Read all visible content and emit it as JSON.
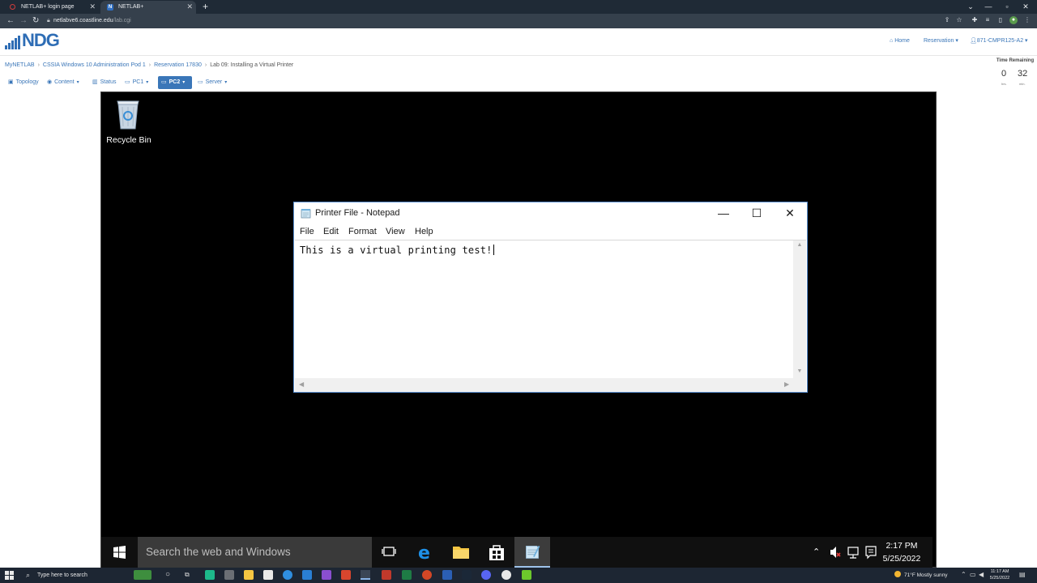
{
  "browser": {
    "tabs": [
      {
        "title": "NETLAB+ login page"
      },
      {
        "title": "NETLAB+"
      }
    ],
    "new_tab": "+",
    "url_host": "netlabve6.coastline.edu",
    "url_path": "/lab.cgi"
  },
  "netlab": {
    "logo_text": "NDG",
    "header": {
      "home": "Home",
      "reservation": "Reservation",
      "user": "871-CMPR125-A2"
    },
    "breadcrumb": [
      "MyNETLAB",
      "CSSIA Windows 10 Administration Pod 1",
      "Reservation 17830",
      "Lab 09: Installing a Virtual Printer"
    ],
    "timer": {
      "label": "Time Remaining",
      "hours": "0",
      "minutes": "32",
      "hours_unit": "hrs.",
      "minutes_unit": "min."
    },
    "tabs": [
      {
        "label": "Topology",
        "icon": "topology-icon"
      },
      {
        "label": "Content",
        "icon": "content-icon"
      },
      {
        "label": "Status",
        "icon": "status-icon"
      },
      {
        "label": "PC1",
        "icon": "monitor-icon"
      },
      {
        "label": "PC2",
        "icon": "monitor-icon",
        "active": true
      },
      {
        "label": "Server",
        "icon": "monitor-icon"
      }
    ]
  },
  "remote": {
    "desktop_icon_label": "Recycle Bin",
    "notepad": {
      "title": "Printer File - Notepad",
      "menu": [
        "File",
        "Edit",
        "Format",
        "View",
        "Help"
      ],
      "content": "This is a virtual printing test!"
    },
    "taskbar": {
      "search_placeholder": "Search the web and Windows",
      "time": "2:17 PM",
      "date": "5/25/2022"
    }
  },
  "host": {
    "search_placeholder": "Type here to search",
    "weather": "71°F  Mostly sunny",
    "time": "11:17 AM",
    "date": "5/25/2022"
  },
  "colors": {
    "accent": "#3a76b8",
    "remote_bg": "#000000",
    "notepad_border": "#5b8fd0"
  }
}
